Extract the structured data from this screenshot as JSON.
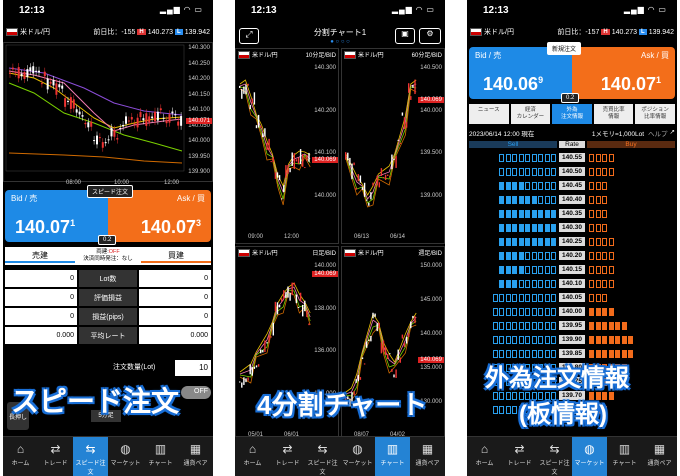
{
  "screens": [
    {
      "time": "12:13",
      "pair": "米ドル/円",
      "prev_label": "前日比：",
      "prev_value": "-155",
      "high": "140.273",
      "low": "139.942",
      "high_tag": "H",
      "low_tag": "L",
      "axis": [
        "140.300",
        "140.250",
        "140.200",
        "140.150",
        "140.100",
        "140.050",
        "140.000",
        "139.950",
        "139.900"
      ],
      "price_tag": "140.071",
      "time_ticks": [
        "08:00",
        "10:00",
        "12:00"
      ],
      "speed_order_label": "スピード注文",
      "bid_label": "Bid / 売",
      "ask_label": "Ask / 買",
      "bid_price_big": "140.07",
      "bid_price_sup": "1",
      "ask_price_big": "140.07",
      "ask_price_sup": "3",
      "spread": "0.2",
      "sell_label": "売建",
      "buy_label": "買建",
      "both_label": "両建:",
      "both_value": "OFF",
      "settle_label": "決済同時発注：なし",
      "rows": [
        {
          "left": "0",
          "label": "Lot数",
          "right": "0"
        },
        {
          "left": "0",
          "label": "評価損益",
          "right": "0"
        },
        {
          "left": "0",
          "label": "損益(pips)",
          "right": "0"
        },
        {
          "left": "0.000",
          "label": "平均レート",
          "right": "0.000"
        }
      ],
      "lot_label": "注文数量(Lot)",
      "lot_value": "10",
      "off_label": "OFF",
      "caption": "スピード注文",
      "pressing_label": "長押し",
      "minutes_label": "5分足"
    },
    {
      "time": "12:13",
      "title": "分割チャート1",
      "charts": [
        {
          "pair": "米ドル/円",
          "frame": "10分足/BID",
          "axis": [
            "140.300",
            "140.200",
            "140.100",
            "140.000"
          ],
          "tag": "140.069",
          "ticks": [
            "09:00",
            "12:00"
          ]
        },
        {
          "pair": "米ドル/円",
          "frame": "60分足/BID",
          "axis": [
            "140.500",
            "140.000",
            "139.500",
            "139.000"
          ],
          "tag": "140.069",
          "ticks": [
            "06/13",
            "06/14"
          ]
        },
        {
          "pair": "米ドル/円",
          "frame": "日足/BID",
          "axis": [
            "140.000",
            "138.000",
            "136.000",
            "134.000"
          ],
          "tag": "140.069",
          "ticks": [
            "05/01",
            "06/01"
          ]
        },
        {
          "pair": "米ドル/円",
          "frame": "週足/BID",
          "axis": [
            "150.000",
            "145.000",
            "140.000",
            "135.000",
            "130.000"
          ],
          "tag": "140.069",
          "ticks": [
            "08/07",
            "04/02"
          ]
        }
      ],
      "caption": "4分割チャート"
    },
    {
      "time": "12:13",
      "pair": "米ドル/円",
      "prev_label": "前日比：",
      "prev_value": "-157",
      "high": "140.273",
      "low": "139.942",
      "high_tag": "H",
      "low_tag": "L",
      "new_order": "新規注文",
      "bid_label": "Bid / 売",
      "ask_label": "Ask / 買",
      "bid_price_big": "140.06",
      "bid_price_sup": "9",
      "ask_price_big": "140.07",
      "ask_price_sup": "1",
      "spread": "0.2",
      "tabs": [
        "ニュース",
        "経済\nカレンダー",
        "外為\n注文情報",
        "売買比率\n情報",
        "ポジション\n比率情報"
      ],
      "datetime": "2023/06/14 12:00 現在",
      "memory": "1メモリ=1,000Lot",
      "help": "ヘルプ",
      "col_sell": "Sell",
      "col_rate": "Rate",
      "col_buy": "Buy",
      "rates": [
        "140.55",
        "140.50",
        "140.45",
        "140.40",
        "140.35",
        "140.30",
        "140.25",
        "140.20",
        "140.15",
        "140.10",
        "140.05",
        "140.00",
        "139.95",
        "139.90",
        "139.85",
        "139.80",
        "139.75",
        "139.70",
        "139.65"
      ],
      "caption_1": "外為注文情報",
      "caption_2": "(板情報)"
    }
  ],
  "nav": [
    "ホーム",
    "トレード",
    "スピード注文",
    "マーケット",
    "チャート",
    "通貨ペア"
  ],
  "nav_active": [
    2,
    4,
    3
  ]
}
